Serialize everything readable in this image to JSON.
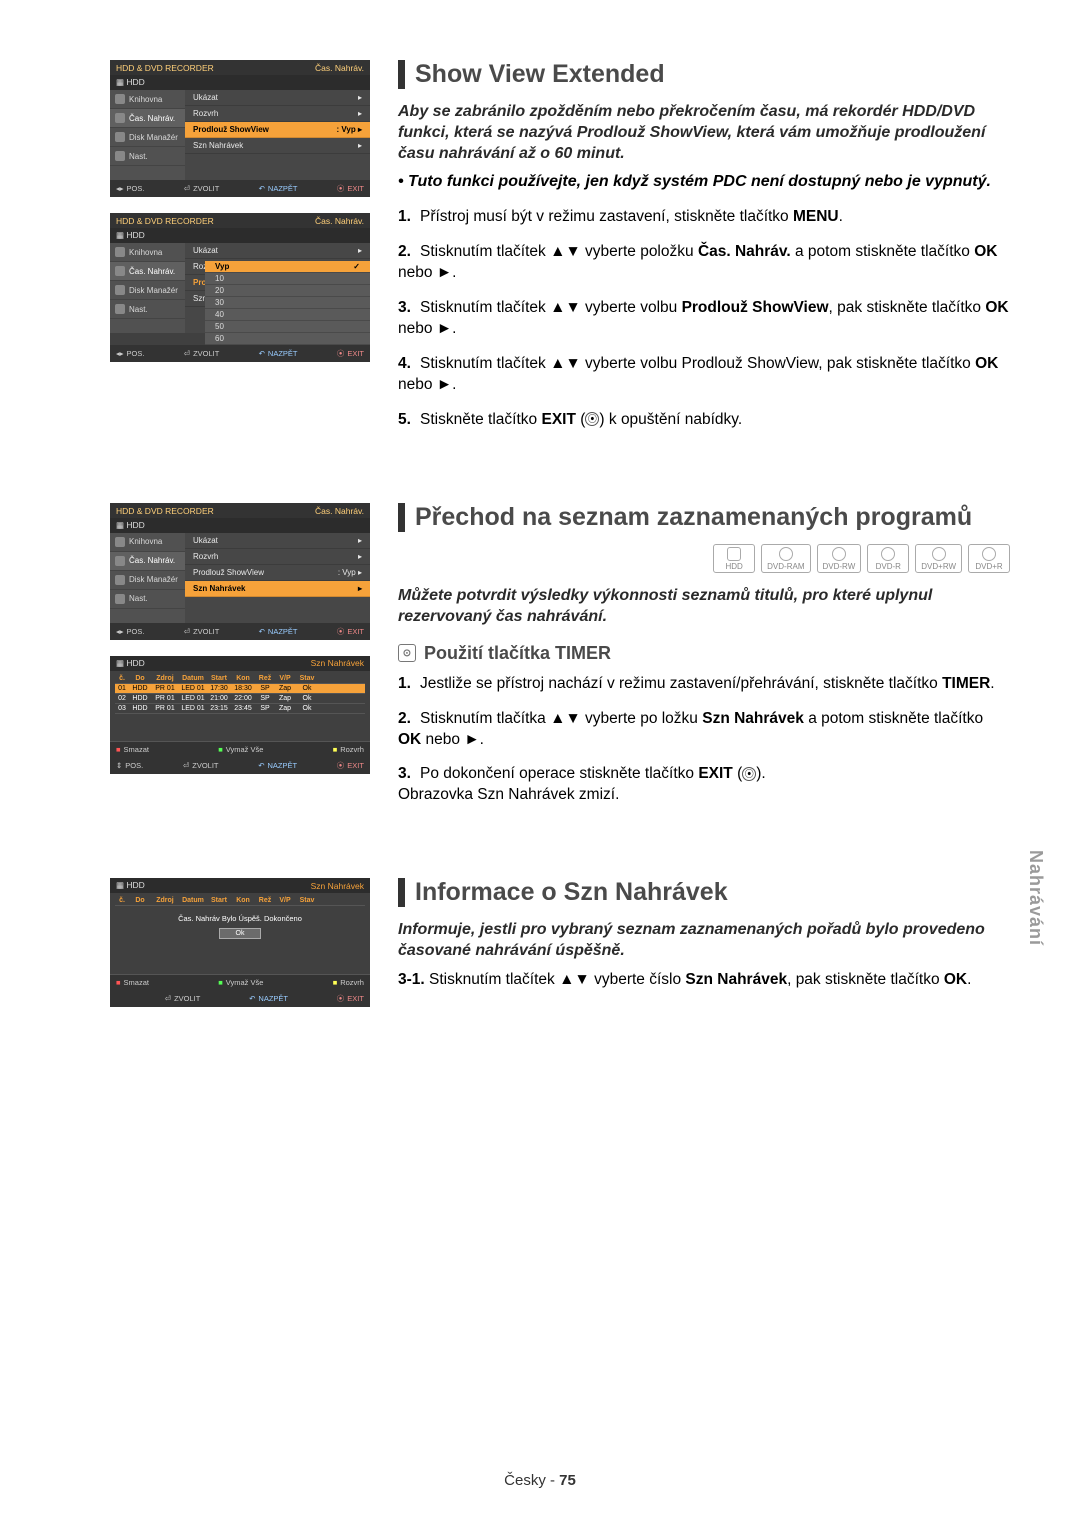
{
  "sidebarTab": "Nahrávání",
  "osd": {
    "header_title": "HDD & DVD RECORDER",
    "header_right": "Čas. Nahráv.",
    "storage": "HDD",
    "side": {
      "knihovna": "Knihovna",
      "cas": "Čas. Nahráv.",
      "disk": "Disk Manažér",
      "nast": "Nast."
    },
    "menu": {
      "ukazat": "Ukázat",
      "rozvrh": "Rozvrh",
      "prodlouz": "Prodlouž ShowView",
      "szn": "Szn Nahrávek",
      "val_vyp": ": Vyp"
    },
    "dropdown": [
      "Vyp",
      "10",
      "20",
      "30",
      "40",
      "50",
      "60"
    ],
    "footer": {
      "pos": "POS.",
      "zvolit": "ZVOLIT",
      "nazpet": "NAZPĚT",
      "exit": "EXIT"
    }
  },
  "osdList": {
    "right_label": "Szn Nahrávek",
    "cols": {
      "c": "č.",
      "do": "Do",
      "zdroj": "Zdroj",
      "datum": "Datum",
      "start": "Start",
      "kon": "Kon",
      "rez": "Rež",
      "vp": "V/P",
      "stav": "Stav"
    },
    "row1": {
      "c": "01",
      "do": "HDD",
      "zdroj": "PR 01",
      "datum": "LED 01",
      "start": "17:30",
      "kon": "18:30",
      "rez": "SP",
      "vp": "Zap",
      "stav": "Ok"
    },
    "row2": {
      "c": "02",
      "do": "HDD",
      "zdroj": "PR 01",
      "datum": "LED 01",
      "start": "21:00",
      "kon": "22:00",
      "rez": "SP",
      "vp": "Zap",
      "stav": "Ok"
    },
    "row3": {
      "c": "03",
      "do": "HDD",
      "zdroj": "PR 01",
      "datum": "LED 01",
      "start": "23:15",
      "kon": "23:45",
      "rez": "SP",
      "vp": "Zap",
      "stav": "Ok"
    },
    "done_msg": "Čas. Nahráv Bylo Úspěš. Dokončeno",
    "ok": "Ok",
    "smazat": "Smazat",
    "vymaz_vse": "Vymaž Vše",
    "rozvrh": "Rozvrh"
  },
  "sec1": {
    "heading": "Show View Extended",
    "intro": "Aby se zabránilo zpožděním nebo překročením času, má rekordér HDD/DVD funkci, která se nazývá Prodlouž ShowView, která vám umožňuje prodloužení času nahrávání až o 60 minut.",
    "bullet": "• Tuto funkci používejte, jen když systém PDC není dostupný nebo je vypnutý.",
    "step1a": "Přístroj musí být v režimu zastavení, stiskněte tlačítko ",
    "step1b": "MENU",
    "step2a": "Stisknutím tlačítek ▲▼ vyberte položku ",
    "step2b": "Čas. Nahráv.",
    "step2c": " a potom stiskněte tlačítko ",
    "step2d": "OK",
    "step2e": " nebo ►.",
    "step3a": "Stisknutím tlačítek ▲▼ vyberte volbu ",
    "step3b": "Prodlouž ShowView",
    "step3c": ", pak stiskněte tlačítko ",
    "step4a": "Stisknutím tlačítek ▲▼ vyberte volbu Prodlouž ShowView, pak stiskněte tlačítko ",
    "step5a": "Stiskněte tlačítko ",
    "step5b": "EXIT",
    "step5c": " k opuštění nabídky."
  },
  "sec2": {
    "heading": "Přechod na seznam zaznamenaných programů",
    "intro": "Můžete potvrdit výsledky výkonnosti seznamů titulů, pro které uplynul rezervovaný čas nahrávání.",
    "subheading": "Použití tlačítka TIMER",
    "step1a": "Jestliže se přístroj nachází v režimu zastavení/přehrávání, stiskněte tlačítko ",
    "step1b": "TIMER",
    "step2a": "Stisknutím tlačítka ▲▼ vyberte po ložku ",
    "step2b": "Szn Nahrávek",
    "step2c": " a potom stiskněte tlačítko ",
    "step2d": "OK",
    "step2e": " nebo ►.",
    "step3a": "Po dokončení operace stiskněte tlačítko ",
    "step3b": "EXIT",
    "step3c": ".",
    "step3d": "Obrazovka Szn Nahrávek zmizí.",
    "discs": [
      "HDD",
      "DVD-RAM",
      "DVD-RW",
      "DVD-R",
      "DVD+RW",
      "DVD+R"
    ]
  },
  "sec3": {
    "heading": "Informace o Szn Nahrávek",
    "intro": "Informuje, jestli pro vybraný seznam zaznamenaných pořadů bylo provedeno časované nahrávání úspěšně.",
    "step_label": "3-1.",
    "step1a": " Stisknutím tlačítek ▲▼ vyberte číslo ",
    "step1b": "Szn Nahrávek",
    "step1c": ", pak stiskněte tlačítko ",
    "step1d": "OK",
    "step1e": "."
  },
  "footer": {
    "lang": "Česky - ",
    "page": "75"
  }
}
